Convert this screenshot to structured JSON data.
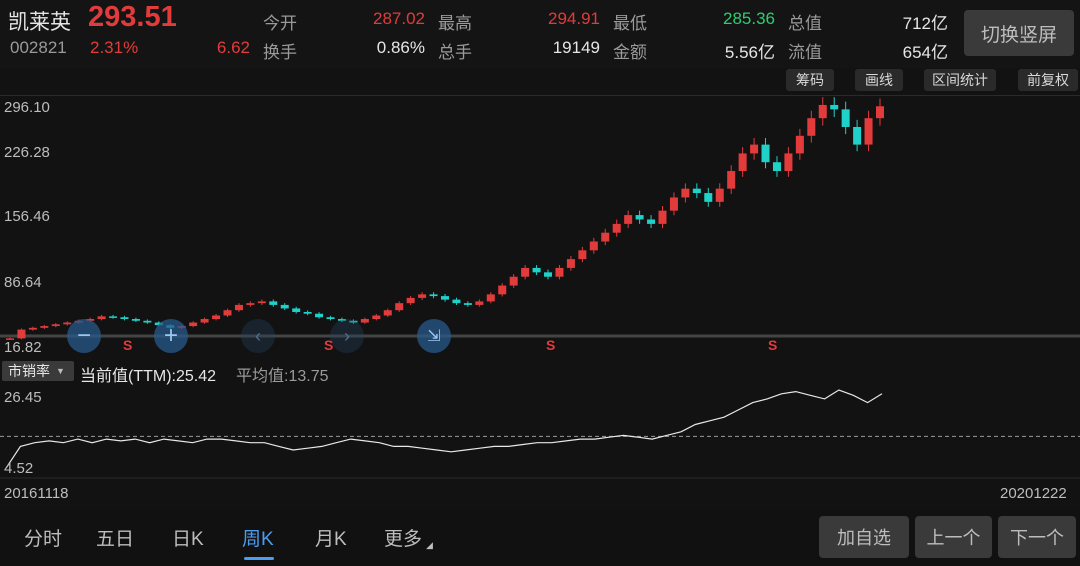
{
  "stock": {
    "name": "凯莱英",
    "code": "002821",
    "price": "293.51",
    "change_pct": "2.31%",
    "change_amt": "6.62"
  },
  "quote": {
    "open_label": "今开",
    "open_value": "287.02",
    "high_label": "最高",
    "high_value": "294.91",
    "low_label": "最低",
    "low_value": "285.36",
    "total_cap_label": "总值",
    "total_cap_value": "712亿",
    "turnover_label": "换手",
    "turnover_value": "0.86%",
    "volume_label": "总手",
    "volume_value": "19149",
    "amount_label": "金额",
    "amount_value": "5.56亿",
    "float_cap_label": "流值",
    "float_cap_value": "654亿"
  },
  "buttons": {
    "switch_portrait": "切换竖屏",
    "chip": "筹码",
    "draw": "画线",
    "interval_stats": "区间统计",
    "forward_adjust": "前复权"
  },
  "price_axis": [
    "296.10",
    "226.28",
    "156.46",
    "86.64",
    "16.82"
  ],
  "sell_marks": [
    "S",
    "S",
    "S",
    "S"
  ],
  "indicator": {
    "select_label": "市销率",
    "current_text": "当前值(TTM):25.42",
    "avg_text": "平均值:13.75",
    "axis_top": "26.45",
    "axis_bottom": "4.52"
  },
  "dates": {
    "start": "20161118",
    "end": "20201222"
  },
  "tabs": [
    "分时",
    "五日",
    "日K",
    "周K",
    "月K",
    "更多"
  ],
  "active_tab": "周K",
  "nav": {
    "add_watch": "加自选",
    "prev": "上一个",
    "next": "下一个"
  },
  "colors": {
    "up": "#e23b3b",
    "down": "#1fd1c8",
    "active": "#4a9df0"
  },
  "chart_data": {
    "type": "candlestick",
    "frequency": "weekly",
    "x_range": [
      "20161118",
      "20201222"
    ],
    "ylim": [
      16.82,
      296.1
    ],
    "closes_approx": [
      30,
      40,
      42,
      44,
      46,
      48,
      50,
      52,
      55,
      54,
      52,
      50,
      48,
      45,
      42,
      44,
      48,
      52,
      56,
      62,
      68,
      70,
      72,
      68,
      64,
      60,
      58,
      54,
      52,
      50,
      48,
      52,
      56,
      62,
      70,
      76,
      80,
      78,
      74,
      70,
      68,
      72,
      80,
      90,
      100,
      110,
      105,
      100,
      110,
      120,
      130,
      140,
      150,
      160,
      170,
      165,
      160,
      175,
      190,
      200,
      195,
      185,
      200,
      220,
      240,
      250,
      230,
      220,
      240,
      260,
      280,
      295,
      290,
      270,
      250,
      280,
      293.51
    ],
    "indicator_series": {
      "name": "市销率",
      "current": 25.42,
      "average": 13.75,
      "ylim": [
        4.52,
        26.45
      ],
      "values_approx": [
        5,
        11,
        12,
        12.5,
        12,
        13,
        12,
        13,
        12.5,
        13,
        12,
        13,
        12.5,
        12,
        13,
        13,
        12.5,
        12,
        12,
        11,
        10,
        10.5,
        11,
        12,
        13,
        12.5,
        12,
        11,
        11,
        10.5,
        10,
        9.5,
        10,
        10.5,
        11,
        11,
        11.5,
        12,
        12,
        12.5,
        13,
        13,
        13.5,
        14,
        13.5,
        13,
        14,
        15,
        17,
        18,
        19,
        21,
        23,
        24,
        25.42,
        26,
        25,
        24,
        26.45,
        25,
        23,
        25.42
      ]
    }
  }
}
